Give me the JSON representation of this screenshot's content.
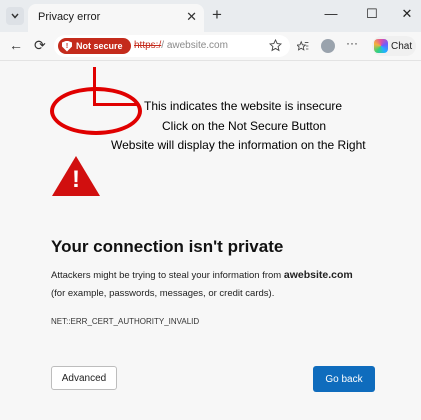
{
  "tab": {
    "title": "Privacy error",
    "close": "✕"
  },
  "window": {
    "minimize": "—",
    "maximize": "☐",
    "close": "✕",
    "new_tab": "+"
  },
  "toolbar": {
    "back": "←",
    "reload": "⟳"
  },
  "address": {
    "badge": "Not secure",
    "scheme": "https:/",
    "slash": "/",
    "host": "awebsite.com",
    "badge_color": "#c42b1c"
  },
  "copilot": {
    "label": "Chat"
  },
  "annotation": {
    "line1": "This indicates the website is insecure",
    "line2": "Click on the Not Secure Button",
    "line3": "Website will display the information on the Right",
    "color": "#e00000"
  },
  "warning": {
    "icon": "warning-triangle-icon",
    "color": "#d10f0f"
  },
  "main": {
    "title": "Your connection isn't private",
    "body_prefix": "Attackers might be trying to steal your information from",
    "site": "awebsite.com",
    "body_suffix": "(for example, passwords, messages, or credit cards).",
    "error_code": "NET::ERR_CERT_AUTHORITY_INVALID",
    "advanced_label": "Advanced",
    "goback_label": "Go back",
    "accent": "#0f6cbd"
  }
}
